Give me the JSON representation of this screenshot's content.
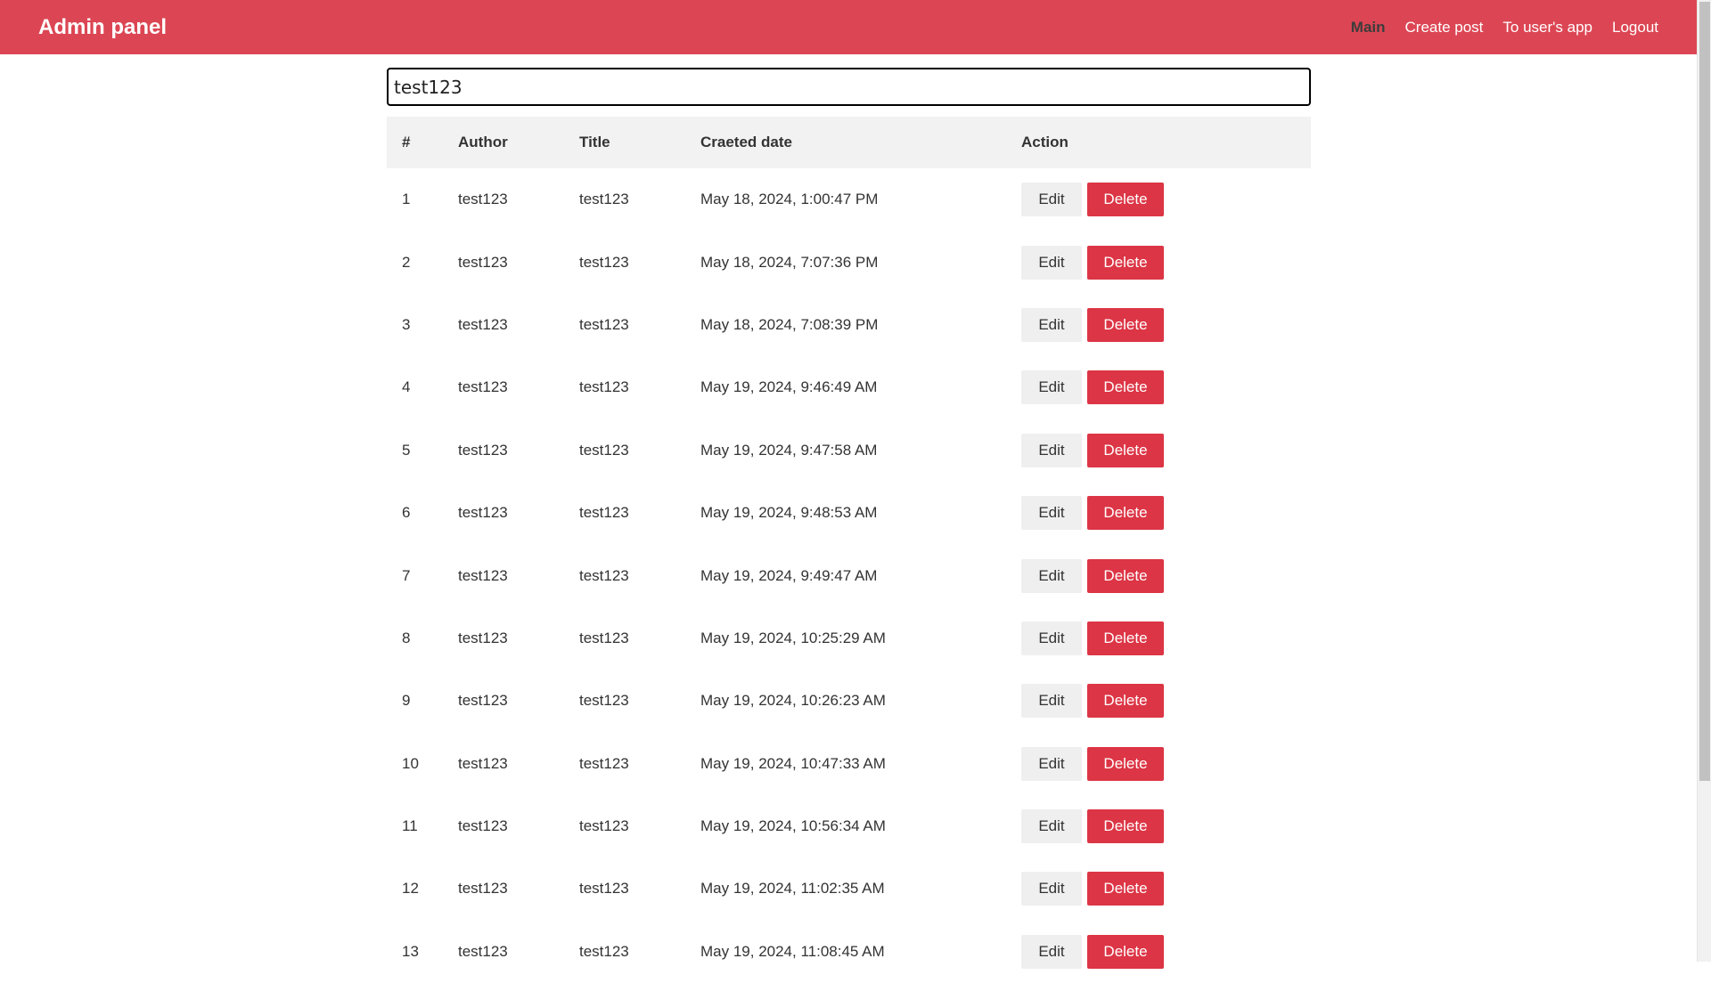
{
  "navbar": {
    "brand": "Admin panel",
    "links": [
      {
        "label": "Main",
        "active": true
      },
      {
        "label": "Create post",
        "active": false
      },
      {
        "label": "To user's app",
        "active": false
      },
      {
        "label": "Logout",
        "active": false
      }
    ]
  },
  "search": {
    "value": "test123"
  },
  "table": {
    "headers": [
      "#",
      "Author",
      "Title",
      "Craeted date",
      "Action"
    ],
    "edit_label": "Edit",
    "delete_label": "Delete",
    "rows": [
      {
        "num": "1",
        "author": "test123",
        "title": "test123",
        "date": "May 18, 2024, 1:00:47 PM"
      },
      {
        "num": "2",
        "author": "test123",
        "title": "test123",
        "date": "May 18, 2024, 7:07:36 PM"
      },
      {
        "num": "3",
        "author": "test123",
        "title": "test123",
        "date": "May 18, 2024, 7:08:39 PM"
      },
      {
        "num": "4",
        "author": "test123",
        "title": "test123",
        "date": "May 19, 2024, 9:46:49 AM"
      },
      {
        "num": "5",
        "author": "test123",
        "title": "test123",
        "date": "May 19, 2024, 9:47:58 AM"
      },
      {
        "num": "6",
        "author": "test123",
        "title": "test123",
        "date": "May 19, 2024, 9:48:53 AM"
      },
      {
        "num": "7",
        "author": "test123",
        "title": "test123",
        "date": "May 19, 2024, 9:49:47 AM"
      },
      {
        "num": "8",
        "author": "test123",
        "title": "test123",
        "date": "May 19, 2024, 10:25:29 AM"
      },
      {
        "num": "9",
        "author": "test123",
        "title": "test123",
        "date": "May 19, 2024, 10:26:23 AM"
      },
      {
        "num": "10",
        "author": "test123",
        "title": "test123",
        "date": "May 19, 2024, 10:47:33 AM"
      },
      {
        "num": "11",
        "author": "test123",
        "title": "test123",
        "date": "May 19, 2024, 10:56:34 AM"
      },
      {
        "num": "12",
        "author": "test123",
        "title": "test123",
        "date": "May 19, 2024, 11:02:35 AM"
      },
      {
        "num": "13",
        "author": "test123",
        "title": "test123",
        "date": "May 19, 2024, 11:08:45 AM"
      }
    ]
  },
  "colors": {
    "navbar_bg": "#dc4654",
    "delete_bg": "#dc3545",
    "edit_bg": "#efefef",
    "header_bg": "#f2f2f2"
  }
}
